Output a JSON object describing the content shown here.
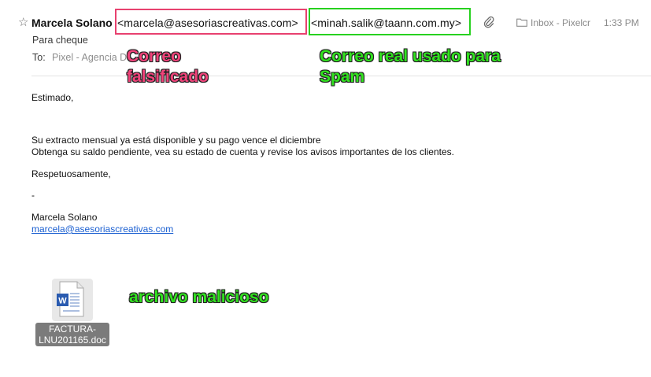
{
  "header": {
    "sender_name": "Marcela Solano",
    "sender_email_shown": "<marcela@asesoriascreativas.com>",
    "sender_email_real": "<minah.salik@taann.com.my>",
    "mailbox": "Inbox - Pixelcr",
    "time": "1:33 PM",
    "subject": "Para cheque",
    "to_label": "To:",
    "to_value": "Pixel - Agencia D"
  },
  "annotations": {
    "fake_email": "Correo falsificado",
    "real_email": "Correo real usado para Spam",
    "malicious_file": "archivo malicioso"
  },
  "body": {
    "greeting": "Estimado,",
    "line1": "Su extracto mensual ya está disponible y su pago vence el diciembre",
    "line2": "Obtenga su saldo pendiente, vea su estado de cuenta y revise los avisos importantes de los clientes.",
    "closing": "Respetuosamente,",
    "dash": "-",
    "signature_name": "Marcela Solano",
    "signature_email": "marcela@asesoriascreativas.com"
  },
  "attachment": {
    "filename": "FACTURA-LNU201165.doc",
    "icon": "word-document-icon"
  },
  "colors": {
    "fake_box": "#e8416f",
    "real_box": "#27d11f",
    "annotation_red": "#f0437a",
    "annotation_green": "#31e21f",
    "link": "#1a5fd1"
  }
}
